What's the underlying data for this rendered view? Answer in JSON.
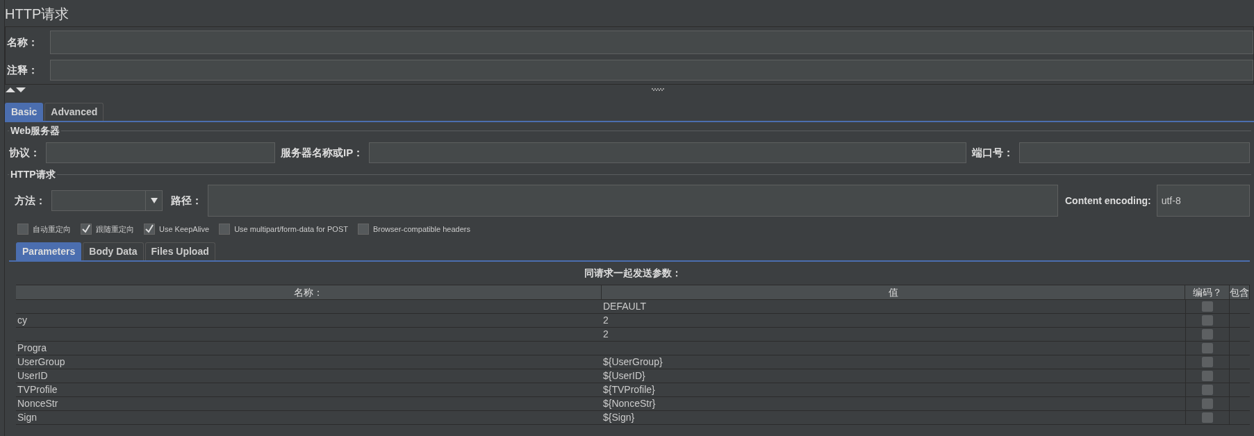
{
  "title": "HTTP请求",
  "name_field": {
    "label": "名称："
  },
  "comment_field": {
    "label": "注释："
  },
  "tabs": [
    {
      "label": "Basic",
      "selected": true
    },
    {
      "label": "Advanced",
      "selected": false
    }
  ],
  "web_server": {
    "legend": "Web服务器",
    "fields": [
      {
        "label": "协议："
      },
      {
        "label": "服务器名称或IP："
      },
      {
        "label": "端口号："
      }
    ]
  },
  "http_request": {
    "legend": "HTTP请求",
    "method_label": "方法：",
    "path_label": "路径：",
    "encoding_label": "Content encoding:",
    "encoding_value": "utf-8",
    "options": [
      {
        "label": "自动重定向",
        "checked": false
      },
      {
        "label": "跟随重定向",
        "checked": true
      },
      {
        "label": "Use KeepAlive",
        "checked": true
      },
      {
        "label": "Use multipart/form-data for POST",
        "checked": false
      },
      {
        "label": "Browser-compatible headers",
        "checked": false
      }
    ]
  },
  "param_tabs": [
    {
      "label": "Parameters",
      "selected": true
    },
    {
      "label": "Body Data",
      "selected": false
    },
    {
      "label": "Files Upload",
      "selected": false
    }
  ],
  "table": {
    "caption": "同请求一起发送参数：",
    "columns": [
      "名称：",
      "值",
      "编码？",
      "包含"
    ],
    "rows": [
      {
        "value": "DEFAULT",
        "encode": false
      },
      {
        "name": "cy",
        "value": "2",
        "encode": false
      },
      {
        "value": "2",
        "encode": false
      },
      {
        "name": "Progra",
        "encode": false
      },
      {
        "name": "UserGroup",
        "value": "${UserGroup}",
        "encode": false
      },
      {
        "name": "UserID",
        "value": "${UserID}",
        "encode": false
      },
      {
        "name": "TVProfile",
        "value": "${TVProfile}",
        "encode": false
      },
      {
        "name": "NonceStr",
        "value": "${NonceStr}",
        "encode": false
      },
      {
        "name": "Sign",
        "value": "${Sign}",
        "encode": false
      }
    ]
  }
}
